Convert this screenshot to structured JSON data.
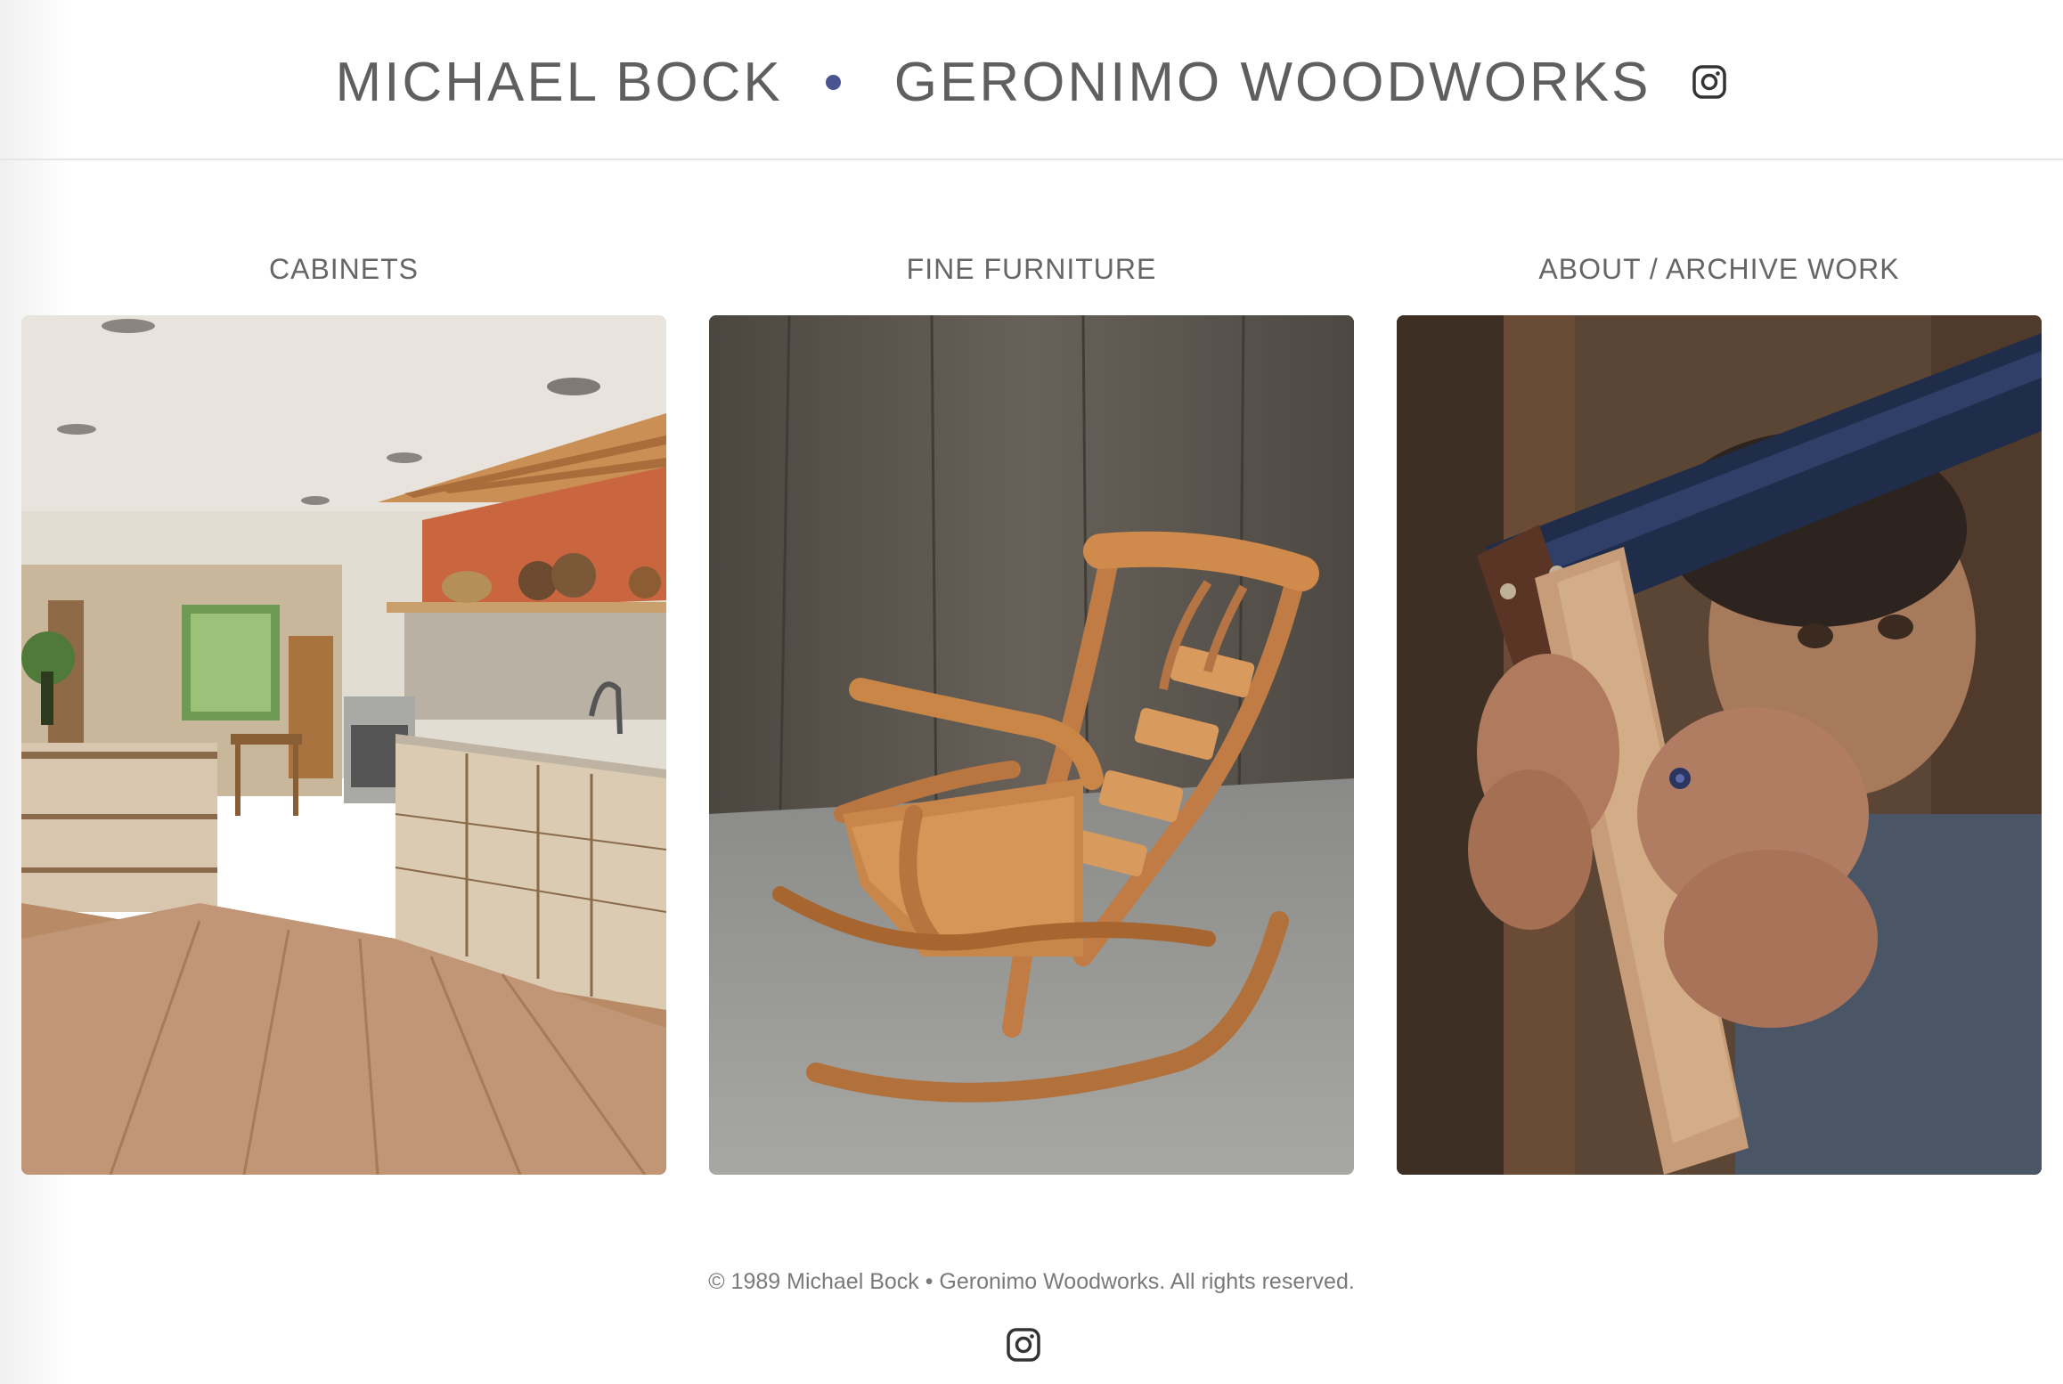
{
  "header": {
    "name_left": "MICHAEL BOCK",
    "name_right": "GERONIMO WOODWORKS",
    "separator_color": "#4a5490",
    "social_icon": "instagram-icon"
  },
  "gallery": {
    "categories": [
      {
        "label": "CABINETS",
        "image": "kitchen-cabinets-photo"
      },
      {
        "label": "FINE FURNITURE",
        "image": "wooden-rocking-chair-photo"
      },
      {
        "label": "ABOUT / ARCHIVE WORK",
        "image": "woodworker-with-square-photo"
      }
    ]
  },
  "footer": {
    "copyright": "© 1989 Michael Bock • Geronimo Woodworks. All rights reserved.",
    "social_icon": "instagram-icon"
  },
  "colors": {
    "text": "#5f5f5f",
    "accent_dot": "#4a5490",
    "divider": "#e6e6e6"
  }
}
